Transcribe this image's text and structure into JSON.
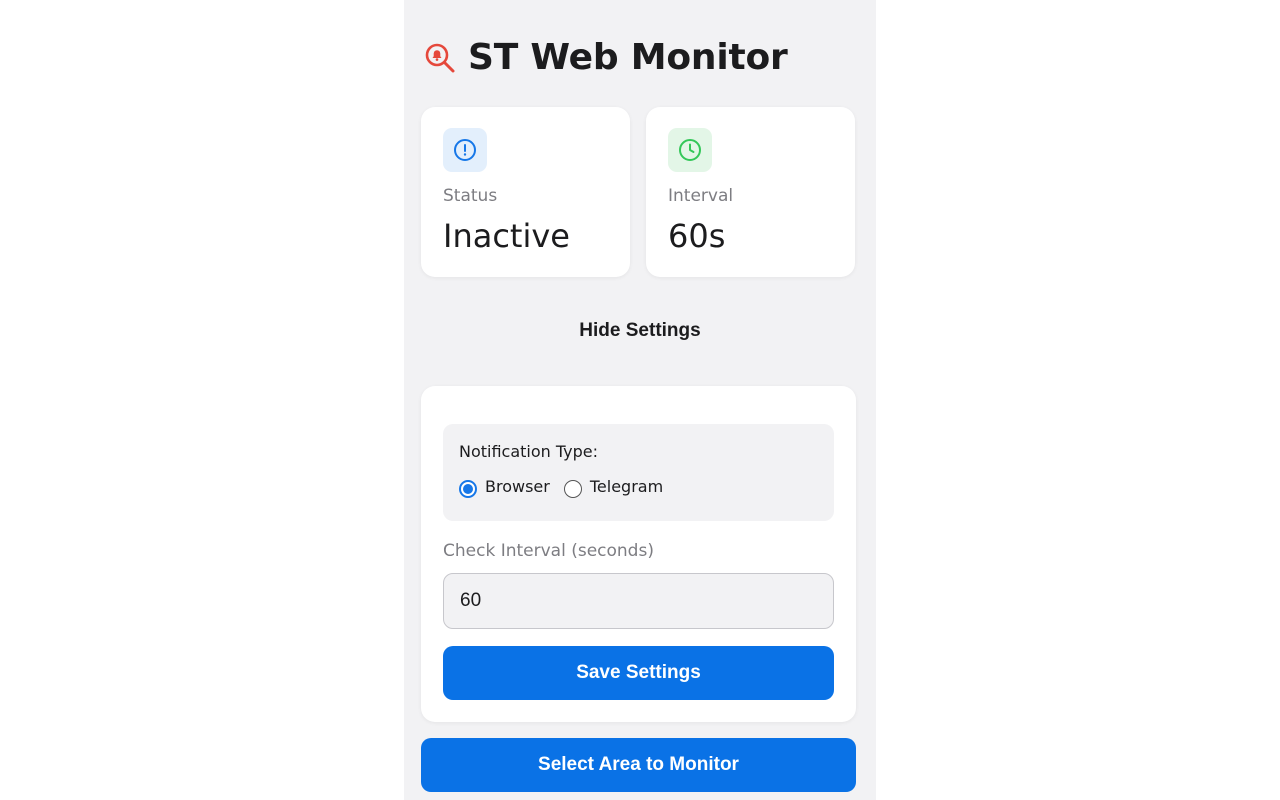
{
  "header": {
    "logo_icon": "bell-search-icon",
    "title": "ST Web Monitor"
  },
  "cards": {
    "status": {
      "icon": "alert-circle-icon",
      "label": "Status",
      "value": "Inactive"
    },
    "interval": {
      "icon": "clock-icon",
      "label": "Interval",
      "value": "60s"
    }
  },
  "settings_toggle": "Hide Settings",
  "settings": {
    "notification_title": "Notification Type:",
    "options": [
      {
        "label": "Browser",
        "selected": true
      },
      {
        "label": "Telegram",
        "selected": false
      }
    ],
    "interval_label": "Check Interval (seconds)",
    "interval_value": "60",
    "save_label": "Save Settings"
  },
  "select_area_label": "Select Area to Monitor",
  "colors": {
    "accent": "#0a72e6",
    "logo": "#e5483b",
    "status_icon": "#1677e8",
    "interval_icon": "#34c759"
  }
}
